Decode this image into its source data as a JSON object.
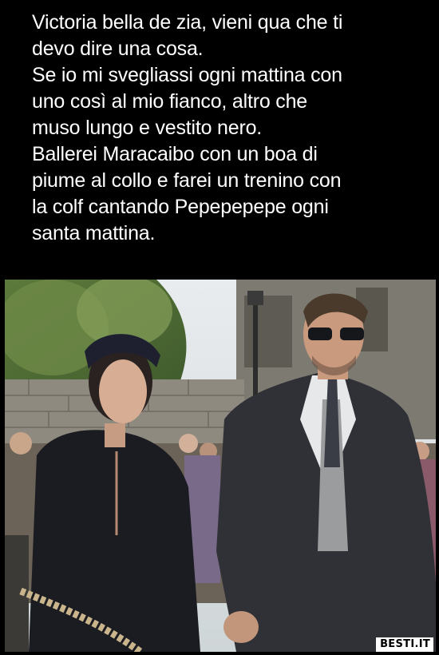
{
  "post": {
    "lines": [
      "Victoria bella de zia, vieni qua che ti",
      "devo dire una cosa.",
      "Se io mi svegliassi ogni mattina con",
      "uno così al mio fianco, altro che",
      "muso lungo e vestito nero.",
      "Ballerei Maracaibo con un boa di",
      "piume al collo e farei un trenino con",
      "la colf cantando Pepepepepe ogni",
      "santa mattina."
    ]
  },
  "watermark": {
    "text": "BESTI.IT"
  },
  "colors": {
    "background": "#000000",
    "text": "#ffffff",
    "watermark_bg": "#ffffff",
    "watermark_text": "#000000"
  }
}
